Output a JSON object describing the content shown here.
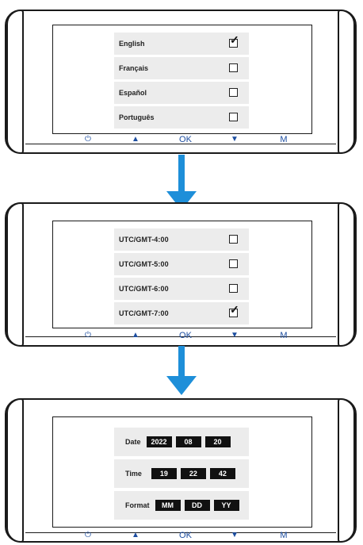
{
  "panel1": {
    "items": [
      {
        "label": "English",
        "checked": true
      },
      {
        "label": "Français",
        "checked": false
      },
      {
        "label": "Español",
        "checked": false
      },
      {
        "label": "Português",
        "checked": false
      }
    ]
  },
  "panel2": {
    "items": [
      {
        "label": "UTC/GMT-4:00",
        "checked": false
      },
      {
        "label": "UTC/GMT-5:00",
        "checked": false
      },
      {
        "label": "UTC/GMT-6:00",
        "checked": false
      },
      {
        "label": "UTC/GMT-7:00",
        "checked": true
      }
    ]
  },
  "panel3": {
    "date": {
      "label": "Date",
      "year": "2022",
      "month": "08",
      "day": "20"
    },
    "time": {
      "label": "Time",
      "hour": "19",
      "minute": "22",
      "second": "42"
    },
    "format": {
      "label": "Format",
      "first": "MM",
      "second": "DD",
      "third": "YY"
    }
  },
  "buttons": {
    "power": "⏻",
    "up": "▲",
    "ok": "OK",
    "down": "▼",
    "menu": "M"
  },
  "colors": {
    "accent": "#1e8fd9",
    "button_text": "#1d4ea0",
    "row_bg": "#ececec"
  },
  "icons": {
    "arrow": "down-arrow-icon",
    "check": "checkmark-icon"
  }
}
